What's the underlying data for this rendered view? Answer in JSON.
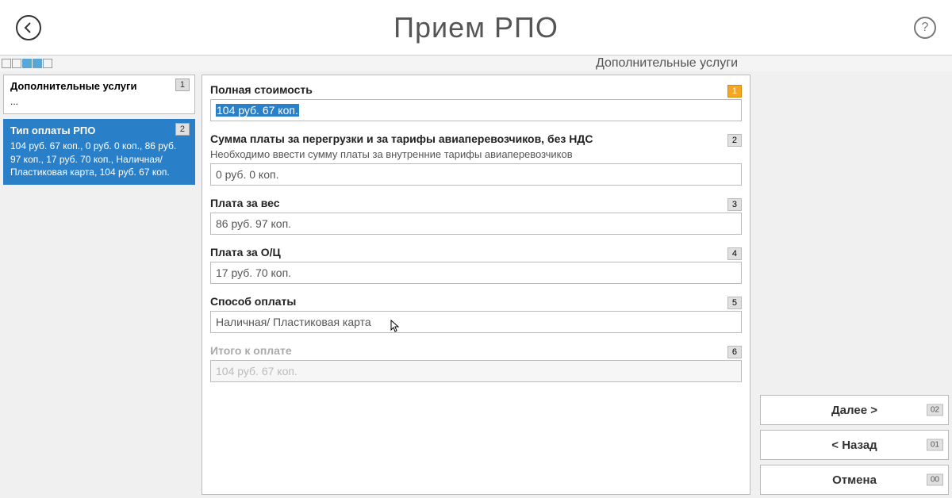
{
  "header": {
    "title": "Прием РПО"
  },
  "subtitle": "Дополнительные услуги",
  "sidebar": [
    {
      "title": "Дополнительные услуги",
      "badge": "1",
      "sub": "...",
      "selected": false
    },
    {
      "title": "Тип оплаты РПО",
      "badge": "2",
      "sub": "104 руб. 67 коп., 0 руб. 0 коп., 86 руб. 97 коп., 17 руб. 70 коп., Наличная/ Пластиковая карта, 104 руб. 67 коп.",
      "selected": true
    }
  ],
  "fields": [
    {
      "label": "Полная стоимость",
      "badge": "1",
      "badgeHighlight": true,
      "value": "104 руб. 67 коп.",
      "highlighted": true
    },
    {
      "label": "Сумма платы за перегрузки и за тарифы авиаперевозчиков, без НДС",
      "badge": "2",
      "hint": "Необходимо ввести сумму платы за внутренние тарифы авиаперевозчиков",
      "value": "0 руб. 0 коп."
    },
    {
      "label": "Плата за вес",
      "badge": "3",
      "value": "86 руб. 97 коп."
    },
    {
      "label": "Плата за О/Ц",
      "badge": "4",
      "value": "17 руб. 70 коп."
    },
    {
      "label": "Способ оплаты",
      "badge": "5",
      "value": "Наличная/ Пластиковая карта"
    },
    {
      "label": "Итого к оплате",
      "badge": "6",
      "value": "104 руб. 67 коп.",
      "disabled": true
    }
  ],
  "buttons": {
    "next": {
      "label": "Далее >",
      "kb": "02"
    },
    "back": {
      "label": "< Назад",
      "kb": "01"
    },
    "cancel": {
      "label": "Отмена",
      "kb": "00"
    }
  }
}
